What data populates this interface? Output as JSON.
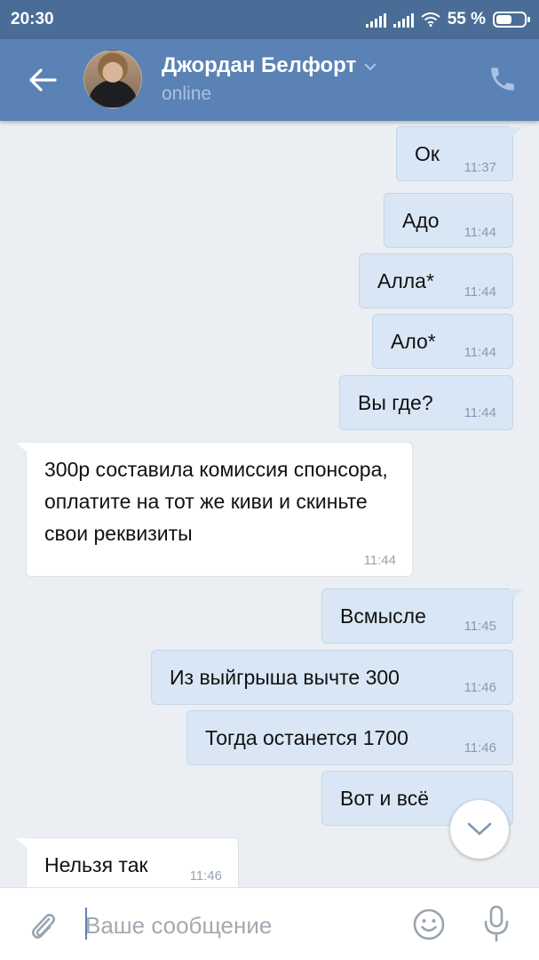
{
  "statusbar": {
    "time": "20:30",
    "battery": "55 %",
    "battery_level": 0.55,
    "icons": [
      "signal-icon",
      "signal-icon",
      "wifi-icon",
      "battery-icon"
    ]
  },
  "header": {
    "name": "Джордан Белфорт",
    "status": "online",
    "icons": [
      "back-arrow-icon",
      "chevron-down-icon",
      "phone-icon"
    ]
  },
  "colors": {
    "statusbar": "#4a6d97",
    "header": "#5b82b5",
    "chat_bg": "#ebeef2",
    "outgoing_bubble": "#d9e6f5",
    "incoming_bubble": "#ffffff"
  },
  "messages": [
    {
      "dir": "out",
      "text": "Ок",
      "time": "11:37"
    },
    {
      "dir": "out",
      "text": "Адо",
      "time": "11:44"
    },
    {
      "dir": "out",
      "text": "Алла*",
      "time": "11:44"
    },
    {
      "dir": "out",
      "text": "Ало*",
      "time": "11:44"
    },
    {
      "dir": "out",
      "text": "Вы где?",
      "time": "11:44"
    },
    {
      "dir": "in",
      "text": "300р составила комиссия спонсора, оплатите на тот же киви и скиньте свои реквизиты",
      "time": "11:44"
    },
    {
      "dir": "out",
      "text": "Всмысле",
      "time": "11:45"
    },
    {
      "dir": "out",
      "text": "Из выйгрыша вычте 300",
      "time": "11:46"
    },
    {
      "dir": "out",
      "text": "Тогда останется 1700",
      "time": "11:46"
    },
    {
      "dir": "out",
      "text": "Вот и всё",
      "time": ""
    },
    {
      "dir": "in",
      "text": "Нельзя так",
      "time": "11:46"
    }
  ],
  "input": {
    "placeholder": "Ваше сообщение",
    "icons": [
      "paperclip-icon",
      "emoji-icon",
      "microphone-icon"
    ]
  }
}
